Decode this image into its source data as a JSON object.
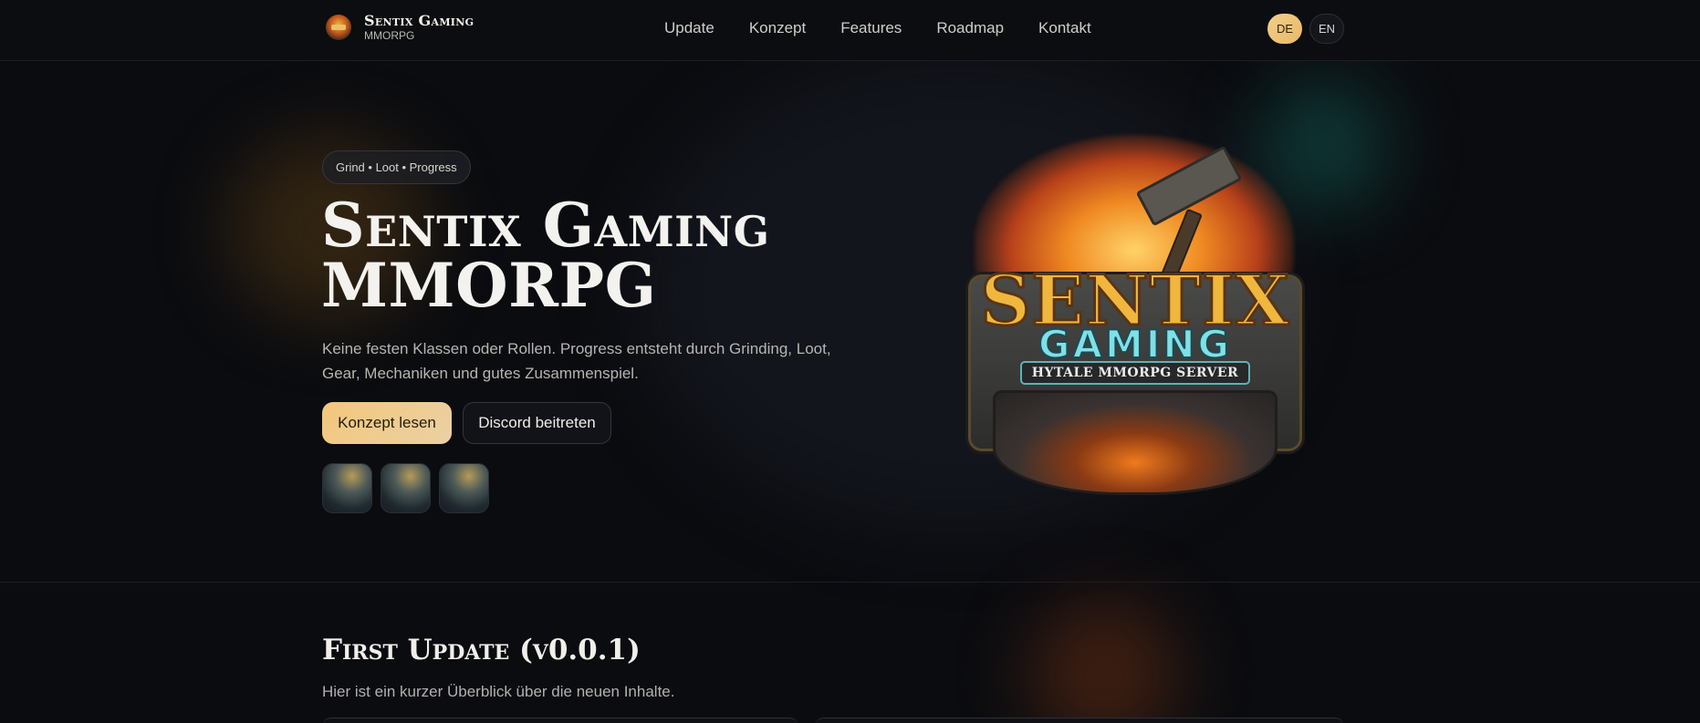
{
  "header": {
    "brand_title": "Sentix Gaming",
    "brand_subtitle": "MMORPG",
    "nav": [
      "Update",
      "Konzept",
      "Features",
      "Roadmap",
      "Kontakt"
    ],
    "languages": [
      "DE",
      "EN"
    ],
    "active_language": "DE"
  },
  "hero": {
    "tagline": "Grind • Loot • Progress",
    "title_line1": "Sentix Gaming",
    "title_line2": "MMORPG",
    "description": "Keine festen Klassen oder Rollen. Progress entsteht durch Grinding, Loot, Gear, Mechaniken und gutes Zusammenspiel.",
    "primary_button": "Konzept lesen",
    "secondary_button": "Discord beitreten",
    "thumbnails": 3
  },
  "emblem": {
    "title": "SENTIX",
    "subtitle": "GAMING",
    "banner": "HYTALE MMORPG SERVER"
  },
  "update_section": {
    "title": "First Update (v0.0.1)",
    "description": "Hier ist ein kurzer Überblick über die neuen Inhalte."
  },
  "colors": {
    "background": "#0b0c10",
    "accent": "#f3c77a",
    "teal": "#7fe0e6"
  }
}
